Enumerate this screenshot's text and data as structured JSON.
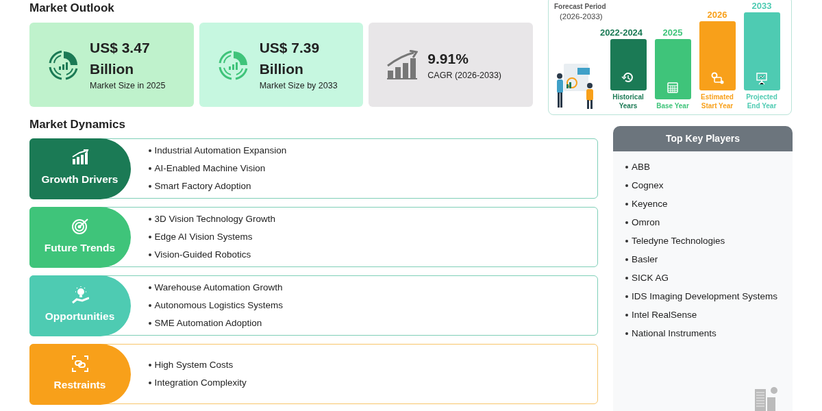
{
  "outlook": {
    "heading": "Market Outlook",
    "stats": [
      {
        "kind": "donut",
        "value": "US$ 3.47 Billion",
        "caption": "Market Size in 2025",
        "color": "#1b7a55"
      },
      {
        "kind": "donut",
        "value": "US$ 7.39 Billion",
        "caption": "Market Size by 2033",
        "color": "#3fc47a"
      },
      {
        "kind": "growth",
        "value": "9.91%",
        "caption": "CAGR (2026-2033)",
        "color": "#777777"
      }
    ]
  },
  "forecast": {
    "title": "Forecast Period",
    "period": "(2026-2033)",
    "stages": [
      {
        "kind": "history",
        "year": "2022-2024",
        "label": "Historical Years",
        "color": "#1b7a55"
      },
      {
        "kind": "calendar",
        "year": "2025",
        "label": "Base Year",
        "color": "#3fc47a"
      },
      {
        "kind": "gear",
        "year": "2026",
        "label": "Estimated Start Year",
        "color": "#f8a01a"
      },
      {
        "kind": "board",
        "year": "2033",
        "label": "Projected End Year",
        "color": "#4ecbb2"
      }
    ]
  },
  "dynamics": {
    "heading": "Market Dynamics",
    "categories": [
      {
        "kind": "growth",
        "title": "Growth Drivers",
        "color": "#1b7a55",
        "points": [
          "Industrial Automation Expansion",
          "AI-Enabled Machine Vision",
          "Smart Factory Adoption"
        ]
      },
      {
        "kind": "target",
        "title": "Future Trends",
        "color": "#3fc47a",
        "points": [
          "3D Vision Technology Growth",
          "Edge AI Vision Systems",
          "Vision-Guided Robotics"
        ]
      },
      {
        "kind": "idea",
        "title": "Opportunities",
        "color": "#4ecbb2",
        "points": [
          "Warehouse Automation Growth",
          "Autonomous Logistics Systems",
          "SME Automation Adoption"
        ]
      },
      {
        "kind": "link",
        "title": "Restraints",
        "color": "#f8a01a",
        "points": [
          "High System Costs",
          "Integration Complexity"
        ]
      }
    ]
  },
  "key_players": {
    "heading": "Top Key Players",
    "items": [
      "ABB",
      "Cognex",
      "Keyence",
      "Omron",
      "Teledyne Technologies",
      "Basler",
      "SICK AG",
      "IDS Imaging Development Systems",
      "Intel RealSense",
      "National Instruments"
    ]
  }
}
